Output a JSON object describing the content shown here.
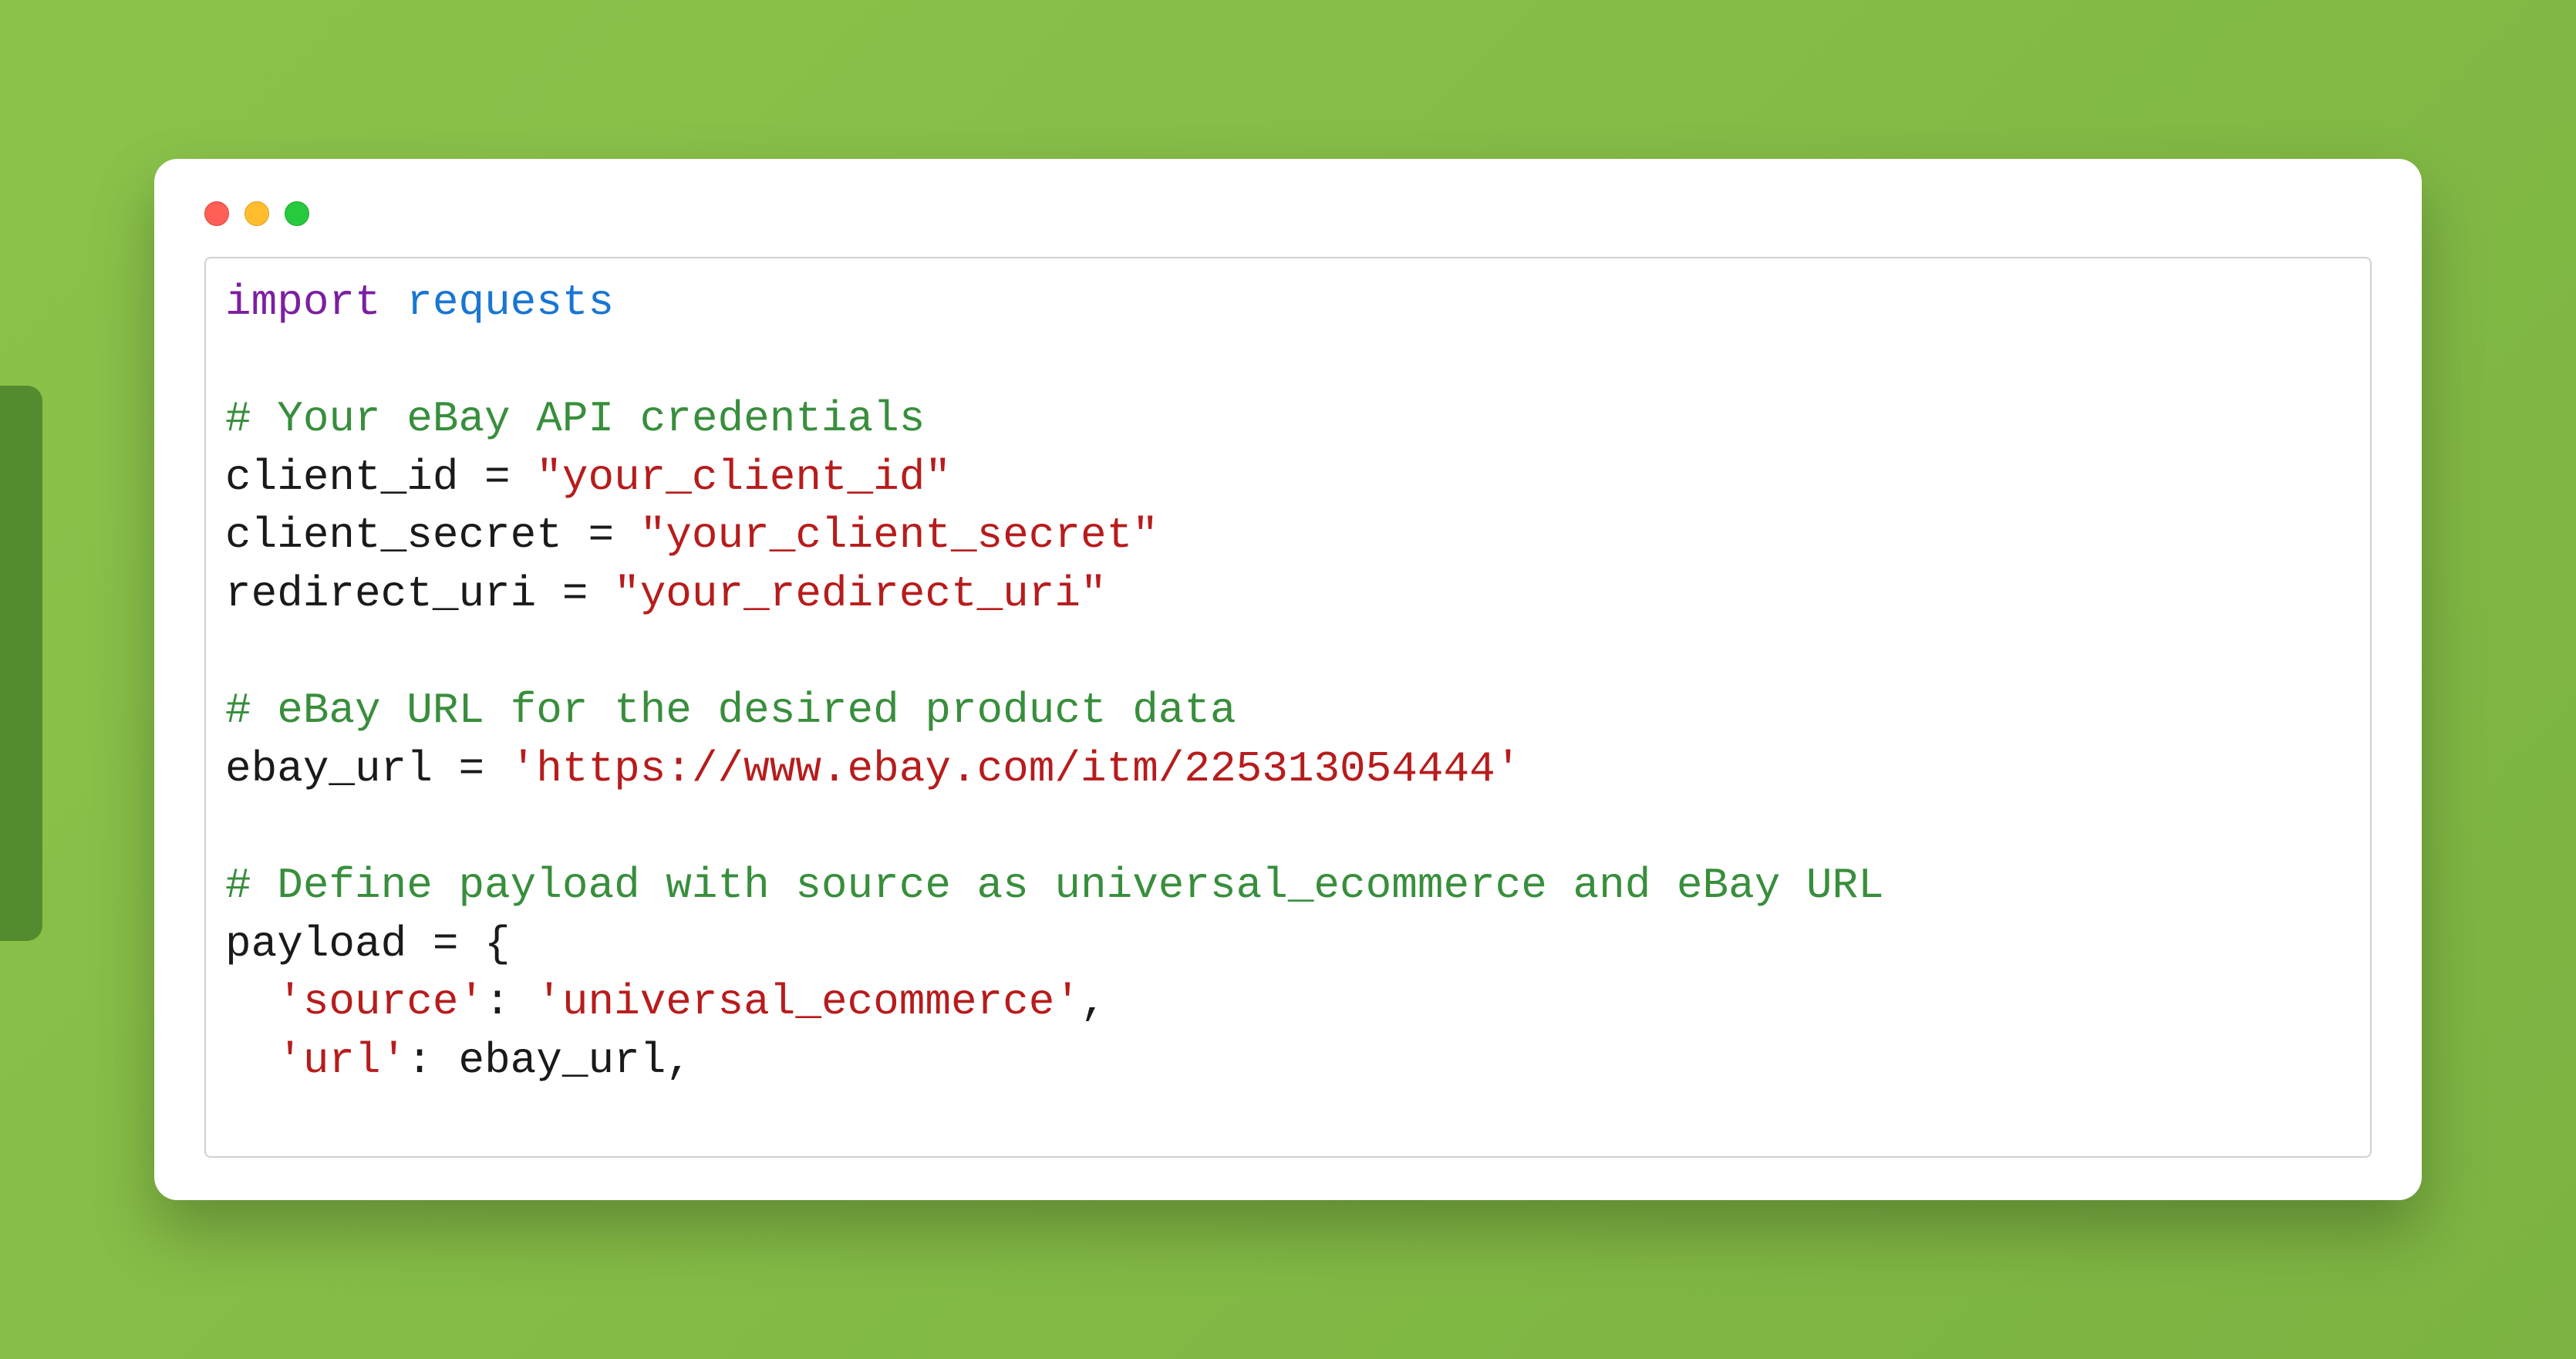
{
  "code": {
    "line1_kw": "import",
    "line1_mod": " requests",
    "blank1": "",
    "comment1": "# Your eBay API credentials",
    "line3a": "client_id = ",
    "line3b": "\"your_client_id\"",
    "line4a": "client_secret = ",
    "line4b": "\"your_client_secret\"",
    "line5a": "redirect_uri = ",
    "line5b": "\"your_redirect_uri\"",
    "blank2": "",
    "comment2": "# eBay URL for the desired product data",
    "line8a": "ebay_url = ",
    "line8b": "'https://www.ebay.com/itm/225313054444'",
    "blank3": "",
    "comment3": "# Define payload with source as universal_ecommerce and eBay URL",
    "line11": "payload = {",
    "line12a": "  ",
    "line12b": "'source'",
    "line12c": ": ",
    "line12d": "'universal_ecommerce'",
    "line12e": ",",
    "line13a": "  ",
    "line13b": "'url'",
    "line13c": ": ebay_url,"
  }
}
